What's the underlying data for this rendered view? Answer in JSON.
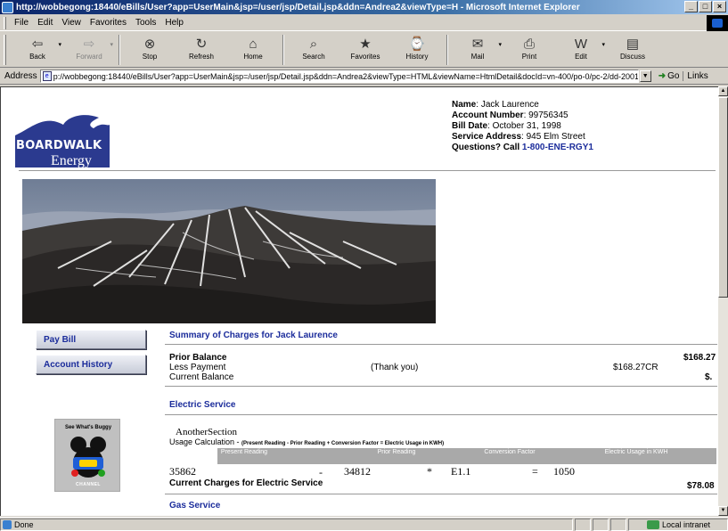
{
  "window": {
    "title": "http://wobbegong:18440/eBills/User?app=UserMain&jsp=/user/jsp/Detail.jsp&ddn=Andrea2&viewType=H - Microsoft Internet Explorer",
    "minimize": "_",
    "restore": "□",
    "close": "×"
  },
  "menu": [
    "File",
    "Edit",
    "View",
    "Favorites",
    "Tools",
    "Help"
  ],
  "toolbar": [
    {
      "label": "Back",
      "icon": "⇦",
      "disabled": false,
      "dropdown": true
    },
    {
      "label": "Forward",
      "icon": "⇨",
      "disabled": true,
      "dropdown": true
    },
    {
      "label": "Stop",
      "icon": "⊗",
      "disabled": false,
      "dropdown": false
    },
    {
      "label": "Refresh",
      "icon": "↻",
      "disabled": false,
      "dropdown": false
    },
    {
      "label": "Home",
      "icon": "⌂",
      "disabled": false,
      "dropdown": false
    },
    {
      "label": "Search",
      "icon": "⌕",
      "disabled": false,
      "dropdown": false
    },
    {
      "label": "Favorites",
      "icon": "★",
      "disabled": false,
      "dropdown": false
    },
    {
      "label": "History",
      "icon": "⌚",
      "disabled": false,
      "dropdown": false
    },
    {
      "label": "Mail",
      "icon": "✉",
      "disabled": false,
      "dropdown": true
    },
    {
      "label": "Print",
      "icon": "⎙",
      "disabled": false,
      "dropdown": false
    },
    {
      "label": "Edit",
      "icon": "W",
      "disabled": false,
      "dropdown": true
    },
    {
      "label": "Discuss",
      "icon": "▤",
      "disabled": false,
      "dropdown": false
    }
  ],
  "address": {
    "label": "Address",
    "url": "p://wobbegong:18440/eBills/User?app=UserMain&jsp=/user/jsp/Detail.jsp&ddn=Andrea2&viewType=HTML&viewName=HtmlDetail&docId=vn-400/po-0/pc-2/dd-20010216",
    "go": "Go",
    "links": "Links"
  },
  "logo": {
    "line1": "BOARDWALK",
    "line2": "Energy"
  },
  "customer": {
    "name_label": "Name",
    "name": "Jack Laurence",
    "account_label": "Account Number",
    "account": "99756345",
    "bill_date_label": "Bill Date",
    "bill_date": "October 31, 1998",
    "service_label": "Service Address",
    "service_address": "945 Elm Street",
    "questions_label": "Questions?  Call",
    "phone": "1-800-ENE-RGY1"
  },
  "nav": {
    "pay_bill": "Pay Bill",
    "account_history": "Account History"
  },
  "ad": {
    "top": "See What's Buggy",
    "bottom": "CHANNEL"
  },
  "summary": {
    "title": "Summary of Charges for Jack Laurence",
    "prior_balance_label": "Prior Balance",
    "prior_balance": "$168.27",
    "less_payment_label": "Less Payment",
    "thank_you": "(Thank you)",
    "payment": "$168.27CR",
    "current_balance_label": "Current Balance",
    "current_balance": "$."
  },
  "electric": {
    "title": "Electric Service",
    "another_section": "AnotherSection",
    "usage_label": "Usage Calculation - ",
    "usage_formula": "(Present Reading - Prior Reading + Conversion Factor = Electric Usage in KWH)",
    "headers": [
      "Present Reading",
      "Prior Reading",
      "Conversion Factor",
      "Electric Usage in KWH"
    ],
    "present": "35862",
    "minus": "-",
    "prior": "34812",
    "times": "*",
    "factor": "E1.1",
    "equals": "=",
    "usage": "1050",
    "current_label": "Current Charges for Electric Service",
    "current_charges": "$78.08"
  },
  "gas": {
    "title": "Gas Service"
  },
  "status": {
    "text": "Done",
    "zone": "Local intranet"
  },
  "colors": {
    "link_blue": "#1b2c9b",
    "logo_blue": "#2b3a8f",
    "titlebar": "#0a246a"
  }
}
